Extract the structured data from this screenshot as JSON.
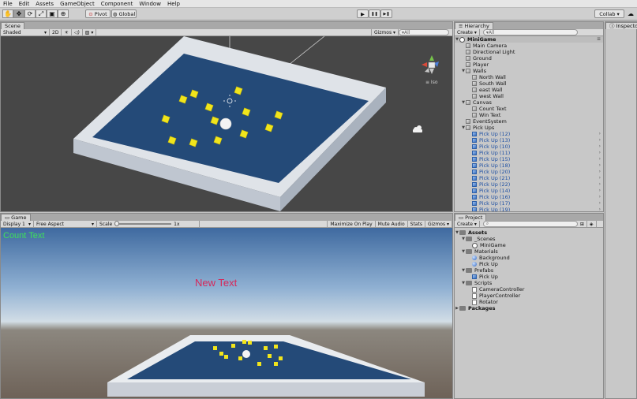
{
  "menu": [
    "File",
    "Edit",
    "Assets",
    "GameObject",
    "Component",
    "Window",
    "Help"
  ],
  "toolbar": {
    "pivot": "Pivot",
    "global": "Global",
    "collab": "Collab ▾",
    "play_icon": "▶",
    "pause_icon": "❚❚",
    "step_icon": "▶❚"
  },
  "scene": {
    "tab": "Scene",
    "shading": "Shaded",
    "mode2d": "2D",
    "gizmos": "Gizmos ▾",
    "search": "▾All",
    "iso": "≡ Iso"
  },
  "game": {
    "tab": "Game",
    "display": "Display 1",
    "aspect": "Free Aspect",
    "scale_label": "Scale",
    "scale_value": "1x",
    "maximize": "Maximize On Play",
    "mute": "Mute Audio",
    "stats": "Stats",
    "gizmos": "Gizmos ▾",
    "count_text": "Count Text",
    "new_text": "New Text"
  },
  "hierarchy": {
    "tab": "Hierarchy",
    "create": "Create ▾",
    "search": "▾All",
    "scene_name": "MiniGame",
    "items": [
      {
        "label": "Main Camera",
        "indent": 1,
        "arrow": "",
        "icon": "cube",
        "prefab": false
      },
      {
        "label": "Directional Light",
        "indent": 1,
        "arrow": "",
        "icon": "cube",
        "prefab": false
      },
      {
        "label": "Ground",
        "indent": 1,
        "arrow": "",
        "icon": "cube",
        "prefab": false
      },
      {
        "label": "Player",
        "indent": 1,
        "arrow": "",
        "icon": "cube",
        "prefab": false
      },
      {
        "label": "Walls",
        "indent": 1,
        "arrow": "▼",
        "icon": "cube",
        "prefab": false
      },
      {
        "label": "North Wall",
        "indent": 2,
        "arrow": "",
        "icon": "cube",
        "prefab": false
      },
      {
        "label": "South Wall",
        "indent": 2,
        "arrow": "",
        "icon": "cube",
        "prefab": false
      },
      {
        "label": "east Wall",
        "indent": 2,
        "arrow": "",
        "icon": "cube",
        "prefab": false
      },
      {
        "label": "west Wall",
        "indent": 2,
        "arrow": "",
        "icon": "cube",
        "prefab": false
      },
      {
        "label": "Canvas",
        "indent": 1,
        "arrow": "▼",
        "icon": "cube",
        "prefab": false
      },
      {
        "label": "Count Text",
        "indent": 2,
        "arrow": "",
        "icon": "cube",
        "prefab": false
      },
      {
        "label": "Win Text",
        "indent": 2,
        "arrow": "",
        "icon": "cube",
        "prefab": false
      },
      {
        "label": "EventSystem",
        "indent": 1,
        "arrow": "",
        "icon": "cube",
        "prefab": false
      },
      {
        "label": "Pick Ups",
        "indent": 1,
        "arrow": "▼",
        "icon": "cube",
        "prefab": false
      },
      {
        "label": "Pick Up (12)",
        "indent": 2,
        "arrow": "",
        "icon": "cube-blue",
        "prefab": true
      },
      {
        "label": "Pick Up (13)",
        "indent": 2,
        "arrow": "",
        "icon": "cube-blue",
        "prefab": true
      },
      {
        "label": "Pick Up (10)",
        "indent": 2,
        "arrow": "",
        "icon": "cube-blue",
        "prefab": true
      },
      {
        "label": "Pick Up (11)",
        "indent": 2,
        "arrow": "",
        "icon": "cube-blue",
        "prefab": true
      },
      {
        "label": "Pick Up (15)",
        "indent": 2,
        "arrow": "",
        "icon": "cube-blue",
        "prefab": true
      },
      {
        "label": "Pick Up (18)",
        "indent": 2,
        "arrow": "",
        "icon": "cube-blue",
        "prefab": true
      },
      {
        "label": "Pick Up (20)",
        "indent": 2,
        "arrow": "",
        "icon": "cube-blue",
        "prefab": true
      },
      {
        "label": "Pick Up (21)",
        "indent": 2,
        "arrow": "",
        "icon": "cube-blue",
        "prefab": true
      },
      {
        "label": "Pick Up (22)",
        "indent": 2,
        "arrow": "",
        "icon": "cube-blue",
        "prefab": true
      },
      {
        "label": "Pick Up (14)",
        "indent": 2,
        "arrow": "",
        "icon": "cube-blue",
        "prefab": true
      },
      {
        "label": "Pick Up (16)",
        "indent": 2,
        "arrow": "",
        "icon": "cube-blue",
        "prefab": true
      },
      {
        "label": "Pick Up (17)",
        "indent": 2,
        "arrow": "",
        "icon": "cube-blue",
        "prefab": true
      },
      {
        "label": "Pick Up (19)",
        "indent": 2,
        "arrow": "",
        "icon": "cube-blue",
        "prefab": true
      }
    ]
  },
  "project": {
    "tab": "Project",
    "create": "Create ▾",
    "items": [
      {
        "label": "Assets",
        "indent": 0,
        "arrow": "▼",
        "icon": "folder",
        "bold": true
      },
      {
        "label": "_Scenes",
        "indent": 1,
        "arrow": "▼",
        "icon": "folder",
        "bold": false
      },
      {
        "label": "MiniGame",
        "indent": 2,
        "arrow": "",
        "icon": "unity",
        "bold": false
      },
      {
        "label": "Materials",
        "indent": 1,
        "arrow": "▼",
        "icon": "folder",
        "bold": false
      },
      {
        "label": "Background",
        "indent": 2,
        "arrow": "",
        "icon": "sphere",
        "bold": false
      },
      {
        "label": "Pick Up",
        "indent": 2,
        "arrow": "",
        "icon": "sphere",
        "bold": false
      },
      {
        "label": "Prefabs",
        "indent": 1,
        "arrow": "▼",
        "icon": "folder",
        "bold": false
      },
      {
        "label": "Pick Up",
        "indent": 2,
        "arrow": "",
        "icon": "cube-blue",
        "bold": false
      },
      {
        "label": "Scripts",
        "indent": 1,
        "arrow": "▼",
        "icon": "folder",
        "bold": false
      },
      {
        "label": "CameraController",
        "indent": 2,
        "arrow": "",
        "icon": "script",
        "bold": false
      },
      {
        "label": "PlayerController",
        "indent": 2,
        "arrow": "",
        "icon": "script",
        "bold": false
      },
      {
        "label": "Rotator",
        "indent": 2,
        "arrow": "",
        "icon": "script",
        "bold": false
      },
      {
        "label": "Packages",
        "indent": 0,
        "arrow": "▶",
        "icon": "folder",
        "bold": true
      }
    ]
  },
  "inspector": {
    "tab": "Inspector"
  },
  "colors": {
    "ground": "#244a78",
    "wall": "#e6eaf0",
    "pickup": "#f1e51c",
    "count_text": "#3ee05a",
    "new_text": "#d6285a"
  }
}
